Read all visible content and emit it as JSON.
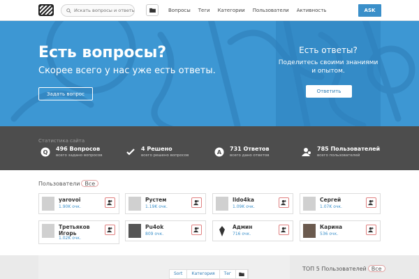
{
  "header": {
    "search_placeholder": "Искать вопросы и ответы",
    "nav": [
      "Вопросы",
      "Теги",
      "Категории",
      "Пользователи",
      "Активность"
    ],
    "ask_label": "ASK"
  },
  "hero": {
    "title": "Есть вопросы?",
    "subtitle": "Скорее всего у нас уже есть ответы.",
    "ask_button": "Задать вопрос",
    "answers_title": "Есть ответы?",
    "answers_subtitle": "Поделитесь своими знаниями и опытом.",
    "answer_button": "Ответить"
  },
  "stats": {
    "title": "Статистика сайта",
    "items": [
      {
        "value": "496 Вопросов",
        "caption": "всего задано вопросов",
        "icon": "question-bubble-icon"
      },
      {
        "value": "4 Решено",
        "caption": "всего решено вопросов",
        "icon": "check-icon"
      },
      {
        "value": "731 Ответов",
        "caption": "всего дано ответов",
        "icon": "answer-bubble-icon"
      },
      {
        "value": "785 Пользователей",
        "caption": "всего пользователей",
        "icon": "users-icon"
      }
    ]
  },
  "users": {
    "title": "Пользователи",
    "all_label": "Все",
    "list": [
      {
        "name": "yarovoi",
        "points": "1.90K очк."
      },
      {
        "name": "Рустем",
        "points": "1.19K очк."
      },
      {
        "name": "lldo4ka",
        "points": "1.09K очк."
      },
      {
        "name": "Сергей",
        "points": "1.07K очк."
      },
      {
        "name": "Третьяков Игорь",
        "points": "1.02K очк."
      },
      {
        "name": "Pu4ok",
        "points": "809 очк."
      },
      {
        "name": "Админ",
        "points": "716 очк."
      },
      {
        "name": "Карина",
        "points": "536 очк."
      }
    ]
  },
  "bottom": {
    "tabs": [
      "Sort",
      "Категория",
      "Тег"
    ],
    "top5_title": "ТОП 5 Пользователей",
    "top5_all": "Все"
  },
  "colors": {
    "accent": "#3a8fc9",
    "hero_bg": "#3d97d3",
    "stats_bg": "#4d4d4d"
  }
}
